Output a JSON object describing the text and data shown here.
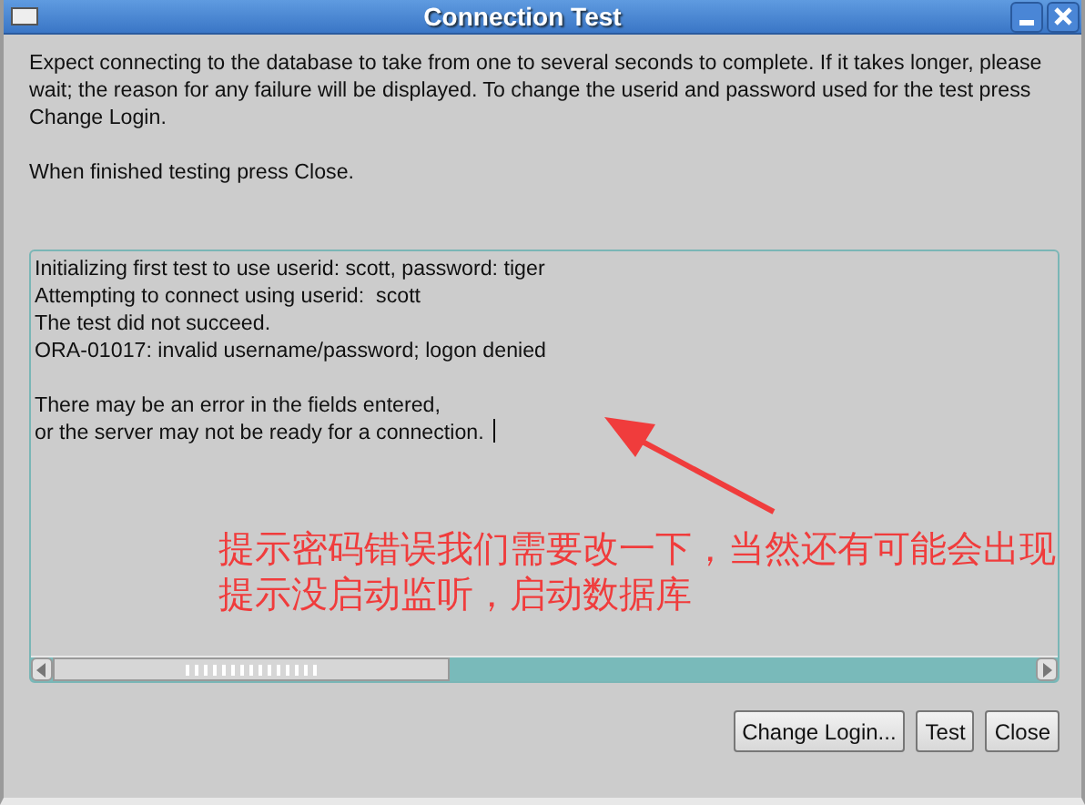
{
  "window": {
    "title": "Connection Test"
  },
  "instructions": [
    "Expect connecting to the database to take from one to several seconds to complete. If it takes longer, please wait; the reason for any failure will be displayed. To change the userid and password used for the test press Change Login.",
    "When finished testing press Close."
  ],
  "log": {
    "blocks": [
      [
        "Initializing first test to use userid: scott, password: tiger",
        "Attempting to connect using userid:  scott",
        "The test did not succeed.",
        "ORA-01017: invalid username/password; logon denied"
      ],
      [
        "There may be an error in the fields entered,",
        "or the server may not be ready for a connection."
      ]
    ]
  },
  "annotation": {
    "text": "提示密码错误我们需要改一下，当然还有可能会出现提示没启动监听，启动数据库"
  },
  "buttons": [
    "Change Login...",
    "Test",
    "Close"
  ]
}
